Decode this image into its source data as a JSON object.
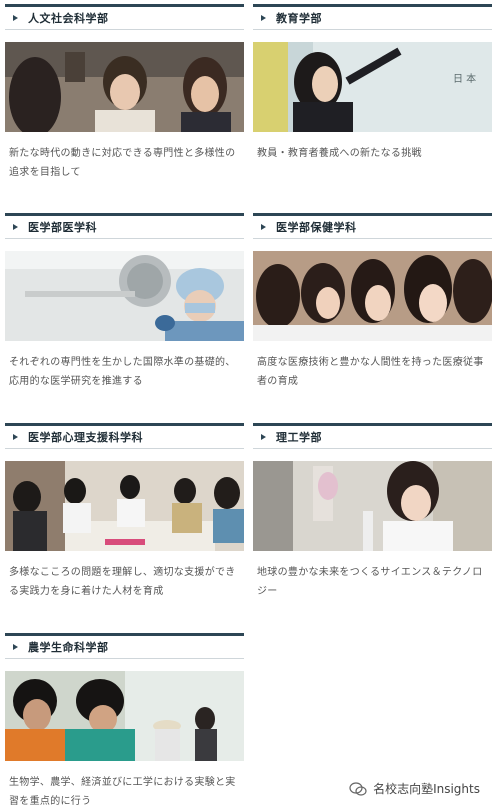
{
  "departments": [
    {
      "title": "人文社会科学部",
      "desc": "新たな時代の動きに対応できる専門性と多様性の追求を目指して"
    },
    {
      "title": "教育学部",
      "desc": "教員・教育者養成への新たなる挑戦"
    },
    {
      "title": "医学部医学科",
      "desc": "それぞれの専門性を生かした国際水準の基礎的、応用的な医学研究を推進する"
    },
    {
      "title": "医学部保健学科",
      "desc": "高度な医療技術と豊かな人間性を持った医療従事者の育成"
    },
    {
      "title": "医学部心理支援科学科",
      "desc": "多様なこころの問題を理解し、適切な支援ができる実践力を身に着けた人材を育成"
    },
    {
      "title": "理工学部",
      "desc": "地球の豊かな未来をつくるサイエンス＆テクノロジー"
    },
    {
      "title": "農学生命科学部",
      "desc": "生物学、農学、経済並びに工学における実験と実習を重点的に行う"
    }
  ],
  "watermark": {
    "label": "名校志向塾Insights"
  }
}
